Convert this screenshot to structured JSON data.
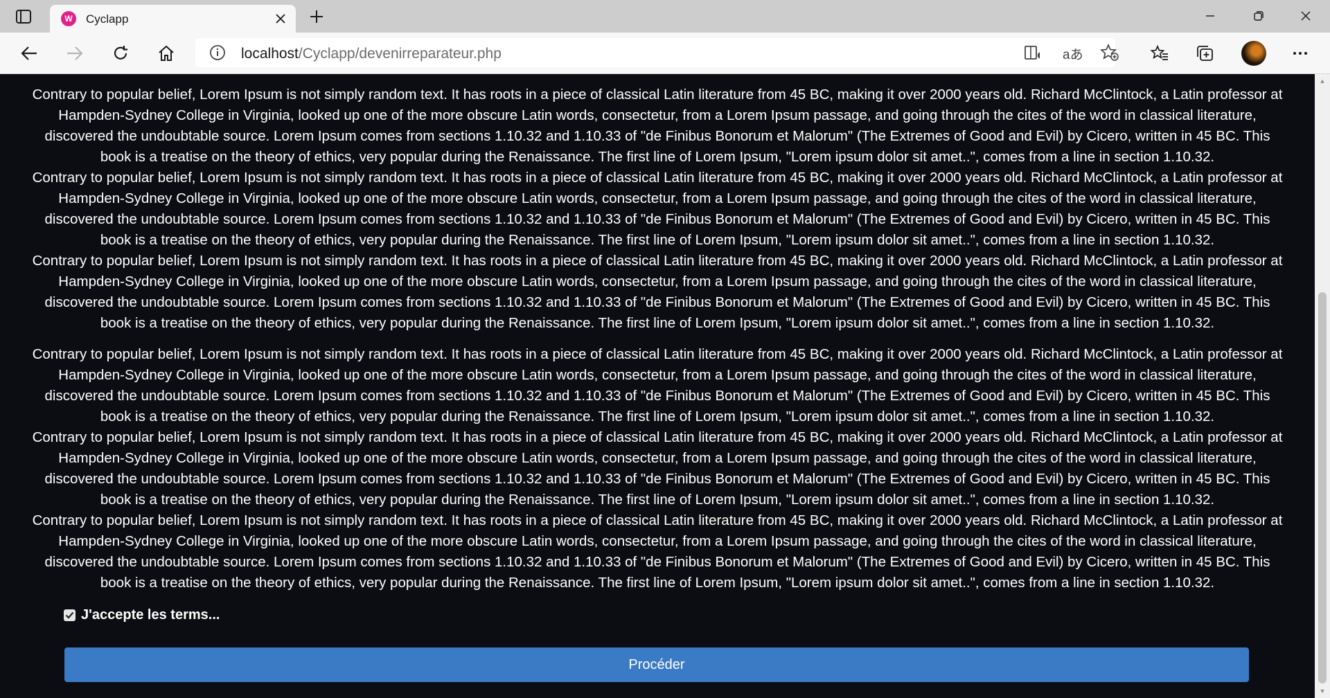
{
  "tab": {
    "title": "Cyclapp",
    "favicon_letter": "W"
  },
  "address": {
    "host": "localhost",
    "path": "/Cyclapp/devenirreparateur.php"
  },
  "content": {
    "paragraph": "Contrary to popular belief, Lorem Ipsum is not simply random text. It has roots in a piece of classical Latin literature from 45 BC, making it over 2000 years old. Richard McClintock, a Latin professor at Hampden-Sydney College in Virginia, looked up one of the more obscure Latin words, consectetur, from a Lorem Ipsum passage, and going through the cites of the word in classical literature, discovered the undoubtable source. Lorem Ipsum comes from sections 1.10.32 and 1.10.33 of \"de Finibus Bonorum et Malorum\" (The Extremes of Good and Evil) by Cicero, written in 45 BC. This book is a treatise on the theory of ethics, very popular during the Renaissance. The first line of Lorem Ipsum, \"Lorem ipsum dolor sit amet..\", comes from a line in section 1.10.32.",
    "terms_label": "J'accepte les terms...",
    "terms_checked": true,
    "proceed_label": "Procéder"
  },
  "colors": {
    "page_background": "#0c0d12",
    "button": "#3b7ac4",
    "favicon": "#e0218a"
  }
}
